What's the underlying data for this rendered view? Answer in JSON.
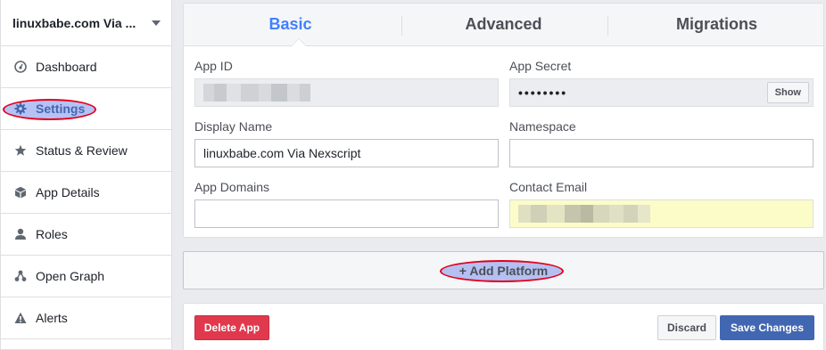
{
  "sidebar": {
    "app_name": "linuxbabe.com Via ...",
    "items": [
      {
        "label": "Dashboard",
        "icon": "dashboard-icon"
      },
      {
        "label": "Settings",
        "icon": "gear-icon"
      },
      {
        "label": "Status & Review",
        "icon": "star-icon"
      },
      {
        "label": "App Details",
        "icon": "cube-icon"
      },
      {
        "label": "Roles",
        "icon": "person-icon"
      },
      {
        "label": "Open Graph",
        "icon": "graph-icon"
      },
      {
        "label": "Alerts",
        "icon": "warning-icon"
      }
    ],
    "active_item": "Settings"
  },
  "tabs": [
    {
      "label": "Basic",
      "active": true
    },
    {
      "label": "Advanced",
      "active": false
    },
    {
      "label": "Migrations",
      "active": false
    }
  ],
  "form": {
    "app_id_label": "App ID",
    "app_secret_label": "App Secret",
    "app_secret_value": "••••••••",
    "show_label": "Show",
    "display_name_label": "Display Name",
    "display_name_value": "linuxbabe.com Via Nexscript",
    "namespace_label": "Namespace",
    "namespace_value": "",
    "app_domains_label": "App Domains",
    "app_domains_value": "",
    "contact_email_label": "Contact Email"
  },
  "platform": {
    "label": "+ Add Platform"
  },
  "footer": {
    "delete_label": "Delete App",
    "discard_label": "Discard",
    "save_label": "Save Changes"
  },
  "colors": {
    "accent": "#4267b2",
    "active_tab": "#4080ff",
    "delete": "#e0394d",
    "annotation_red": "#e3001b",
    "annotation_fill": "#9dadf0"
  }
}
